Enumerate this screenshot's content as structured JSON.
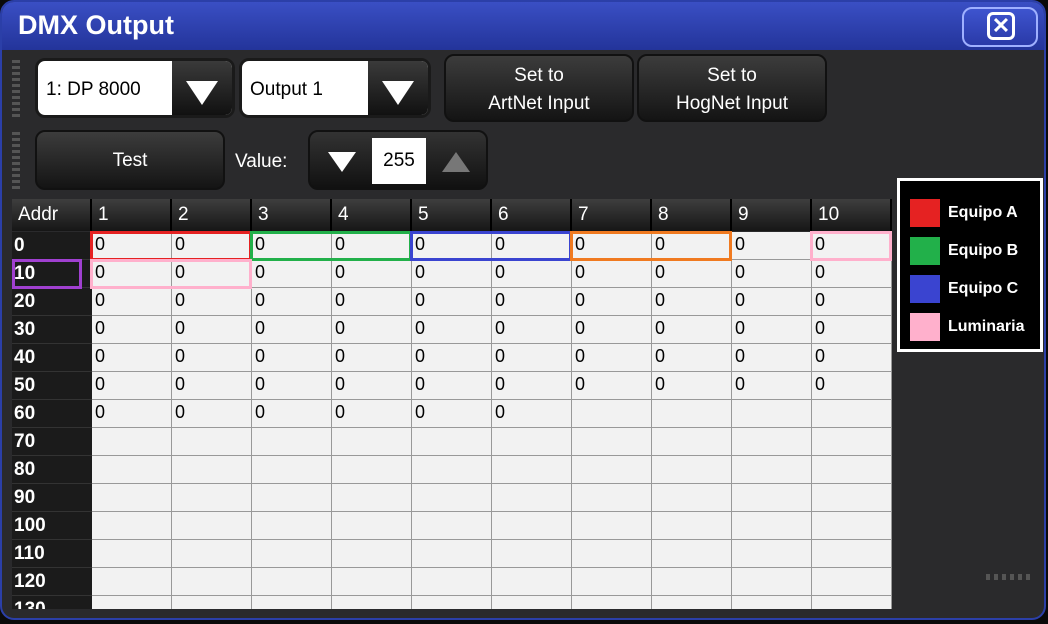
{
  "window": {
    "title": "DMX Output",
    "close_icon": "close-icon"
  },
  "toolbar": {
    "fixture_select": "1: DP 8000",
    "output_select": "Output 1",
    "set_artnet": [
      "Set to",
      "ArtNet Input"
    ],
    "set_hognet": [
      "Set to",
      "HogNet Input"
    ],
    "test_label": "Test",
    "value_label": "Value:",
    "value": "255"
  },
  "grid": {
    "corner": "Addr",
    "columns": [
      "1",
      "2",
      "3",
      "4",
      "5",
      "6",
      "7",
      "8",
      "9",
      "10"
    ],
    "rows": [
      {
        "addr": "0",
        "cells": [
          "0",
          "0",
          "0",
          "0",
          "0",
          "0",
          "0",
          "0",
          "0",
          "0"
        ]
      },
      {
        "addr": "10",
        "cells": [
          "0",
          "0",
          "0",
          "0",
          "0",
          "0",
          "0",
          "0",
          "0",
          "0"
        ]
      },
      {
        "addr": "20",
        "cells": [
          "0",
          "0",
          "0",
          "0",
          "0",
          "0",
          "0",
          "0",
          "0",
          "0"
        ]
      },
      {
        "addr": "30",
        "cells": [
          "0",
          "0",
          "0",
          "0",
          "0",
          "0",
          "0",
          "0",
          "0",
          "0"
        ]
      },
      {
        "addr": "40",
        "cells": [
          "0",
          "0",
          "0",
          "0",
          "0",
          "0",
          "0",
          "0",
          "0",
          "0"
        ]
      },
      {
        "addr": "50",
        "cells": [
          "0",
          "0",
          "0",
          "0",
          "0",
          "0",
          "0",
          "0",
          "0",
          "0"
        ]
      },
      {
        "addr": "60",
        "cells": [
          "0",
          "0",
          "0",
          "0",
          "0",
          "0",
          "",
          "",
          "",
          ""
        ]
      },
      {
        "addr": "70",
        "cells": [
          "",
          "",
          "",
          "",
          "",
          "",
          "",
          "",
          "",
          ""
        ]
      },
      {
        "addr": "80",
        "cells": [
          "",
          "",
          "",
          "",
          "",
          "",
          "",
          "",
          "",
          ""
        ]
      },
      {
        "addr": "90",
        "cells": [
          "",
          "",
          "",
          "",
          "",
          "",
          "",
          "",
          "",
          ""
        ]
      },
      {
        "addr": "100",
        "cells": [
          "",
          "",
          "",
          "",
          "",
          "",
          "",
          "",
          "",
          ""
        ]
      },
      {
        "addr": "110",
        "cells": [
          "",
          "",
          "",
          "",
          "",
          "",
          "",
          "",
          "",
          ""
        ]
      },
      {
        "addr": "120",
        "cells": [
          "",
          "",
          "",
          "",
          "",
          "",
          "",
          "",
          "",
          ""
        ]
      },
      {
        "addr": "130",
        "cells": [
          "",
          "",
          "",
          "",
          "",
          "",
          "",
          "",
          "",
          ""
        ]
      }
    ]
  },
  "highlights": [
    {
      "name": "Equipo A",
      "color": "#e52222",
      "row": 0,
      "col": 0,
      "span": 2
    },
    {
      "name": "Equipo B",
      "color": "#22b04a",
      "row": 0,
      "col": 2,
      "span": 2
    },
    {
      "name": "Equipo C",
      "color": "#3a44d0",
      "row": 0,
      "col": 4,
      "span": 2
    },
    {
      "name": "orange",
      "color": "#f07a20",
      "row": 0,
      "col": 6,
      "span": 2
    },
    {
      "name": "Luminaria",
      "color": "#ffb0cc",
      "row": 0,
      "col": 9,
      "span": 1
    },
    {
      "name": "Luminaria",
      "color": "#ffb0cc",
      "row": 1,
      "col": 0,
      "span": 2
    }
  ],
  "legend": [
    {
      "label": "Equipo A",
      "color": "#e52222"
    },
    {
      "label": "Equipo B",
      "color": "#22b04a"
    },
    {
      "label": "Equipo C",
      "color": "#3a44d0"
    },
    {
      "label": "Luminaria",
      "color": "#ffb0cc"
    }
  ]
}
